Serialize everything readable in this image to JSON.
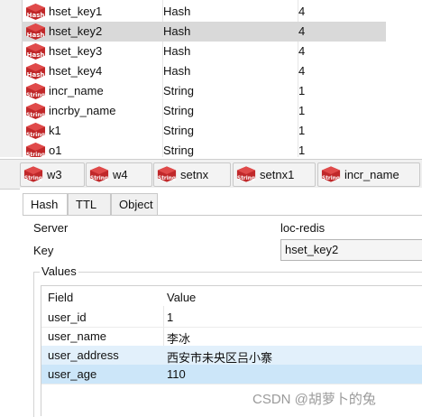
{
  "keys": [
    {
      "name": "hset_key1",
      "type": "Hash",
      "size": "4",
      "icon": "Hash"
    },
    {
      "name": "hset_key2",
      "type": "Hash",
      "size": "4",
      "icon": "Hash"
    },
    {
      "name": "hset_key3",
      "type": "Hash",
      "size": "4",
      "icon": "Hash"
    },
    {
      "name": "hset_key4",
      "type": "Hash",
      "size": "4",
      "icon": "Hash"
    },
    {
      "name": "incr_name",
      "type": "String",
      "size": "1",
      "icon": "String"
    },
    {
      "name": "incrby_name",
      "type": "String",
      "size": "1",
      "icon": "String"
    },
    {
      "name": "k1",
      "type": "String",
      "size": "1",
      "icon": "String"
    },
    {
      "name": "o1",
      "type": "String",
      "size": "1",
      "icon": "String"
    }
  ],
  "tabs": [
    {
      "label": "w3",
      "icon": "String"
    },
    {
      "label": "w4",
      "icon": "String"
    },
    {
      "label": "setnx",
      "icon": "String"
    },
    {
      "label": "setnx1",
      "icon": "String"
    },
    {
      "label": "incr_name",
      "icon": "String"
    }
  ],
  "subtabs": [
    "Hash",
    "TTL",
    "Object"
  ],
  "detail": {
    "server_label": "Server",
    "server_value": "loc-redis",
    "key_label": "Key",
    "key_value": "hset_key2",
    "values_title": "Values",
    "col_field": "Field",
    "col_value": "Value"
  },
  "rows": [
    {
      "field": "user_id",
      "value": "1"
    },
    {
      "field": "user_name",
      "value": "李冰"
    },
    {
      "field": "user_address",
      "value": "西安市未央区吕小寨"
    },
    {
      "field": "user_age",
      "value": "110"
    }
  ],
  "watermark": "CSDN @胡萝卜的兔",
  "colors": {
    "icon_red": "#c0282a",
    "selected_row": "#d9d9d9",
    "grid_highlight": "#e2f0fb",
    "grid_selected": "#cce6f9"
  }
}
